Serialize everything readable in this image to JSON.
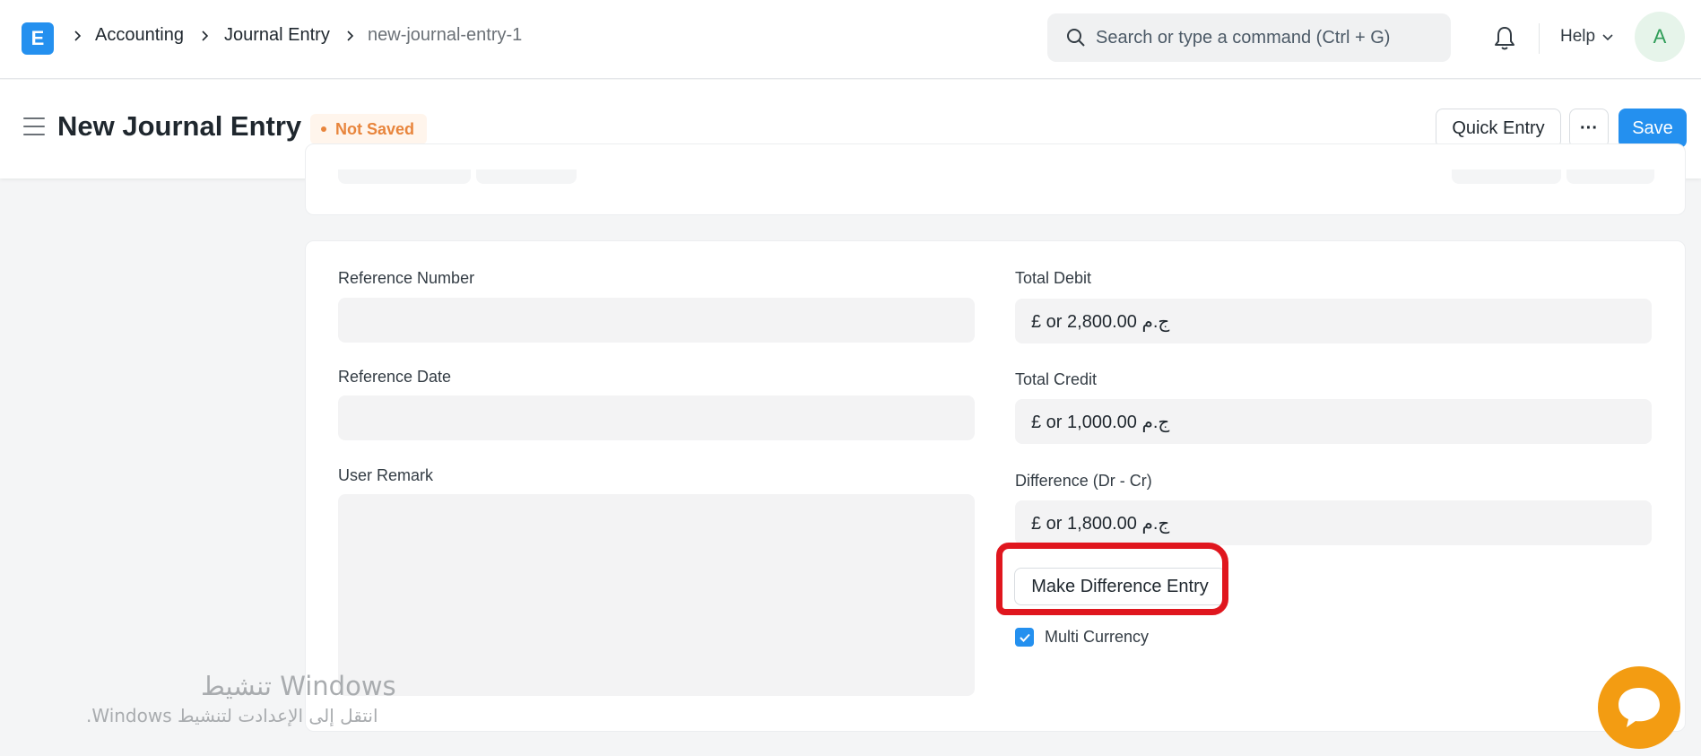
{
  "navbar": {
    "logo_letter": "E",
    "breadcrumbs": [
      "Accounting",
      "Journal Entry",
      "new-journal-entry-1"
    ],
    "search_placeholder": "Search or type a command (Ctrl + G)",
    "help_label": "Help",
    "avatar_initial": "A"
  },
  "page": {
    "title": "New Journal Entry",
    "status_badge": "Not Saved",
    "quick_entry_label": "Quick Entry",
    "more_label": "···",
    "save_label": "Save"
  },
  "form": {
    "reference_number_label": "Reference Number",
    "reference_number_value": "",
    "reference_date_label": "Reference Date",
    "reference_date_value": "",
    "user_remark_label": "User Remark",
    "user_remark_value": "",
    "total_debit_label": "Total Debit",
    "total_debit_value": "£ or 2,800.00 ج.م",
    "total_credit_label": "Total Credit",
    "total_credit_value": "£ or 1,000.00 ج.م",
    "difference_label": "Difference (Dr - Cr)",
    "difference_value": "£ or 1,800.00 ج.م",
    "make_difference_entry_label": "Make Difference Entry",
    "multi_currency_label": "Multi Currency",
    "multi_currency_checked": true
  },
  "watermark": {
    "line1": "تنشيط Windows",
    "line2": "انتقل إلى الإعدادت لتنشيط Windows."
  },
  "colors": {
    "primary": "#2490ef",
    "warning": "#e8853c",
    "annotation_red": "#e0161e",
    "chat_orange": "#f39c12"
  }
}
